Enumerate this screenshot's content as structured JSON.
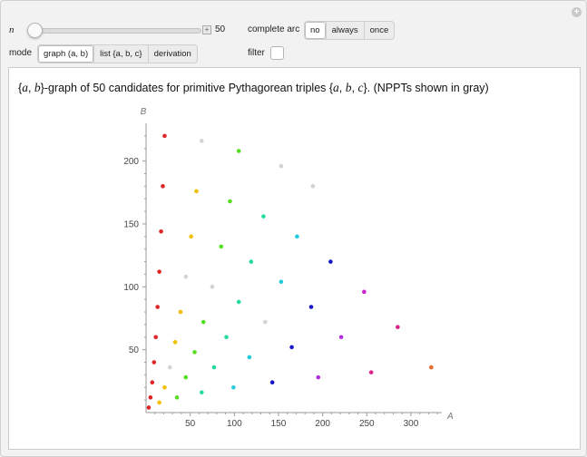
{
  "controls": {
    "n_label": "n",
    "n_value": "50",
    "n_slider_fraction": 0.02,
    "complete_arc_label": "complete arc",
    "complete_arc_options": [
      "no",
      "always",
      "once"
    ],
    "complete_arc_selected": "no",
    "mode_label": "mode",
    "mode_options": [
      "graph (a, b)",
      "list {a, b, c}",
      "derivation"
    ],
    "mode_selected": "graph (a, b)",
    "filter_label": "filter",
    "filter_checked": false
  },
  "caption": {
    "prefix": "{",
    "a1": "a",
    "comma1": ", ",
    "b1": "b",
    "middle": "}-graph of 50 candidates for primitive Pythagorean triples {",
    "a2": "a",
    "comma2": ", ",
    "b2": "b",
    "comma3": ", ",
    "c2": "c",
    "suffix": "}. (NPPTs shown in gray)"
  },
  "chart_data": {
    "type": "scatter",
    "title": "",
    "xlabel": "A",
    "ylabel": "B",
    "xlim": [
      0,
      335
    ],
    "ylim": [
      0,
      230
    ],
    "xticks": [
      50,
      100,
      150,
      200,
      250,
      300
    ],
    "yticks": [
      50,
      100,
      150,
      200
    ],
    "grid": false,
    "points": [
      {
        "x": 3,
        "y": 4,
        "color": "#e02424"
      },
      {
        "x": 5,
        "y": 12,
        "color": "#e02424"
      },
      {
        "x": 7,
        "y": 24,
        "color": "#e02424"
      },
      {
        "x": 9,
        "y": 40,
        "color": "#e02424"
      },
      {
        "x": 11,
        "y": 60,
        "color": "#e02424"
      },
      {
        "x": 13,
        "y": 84,
        "color": "#e02424"
      },
      {
        "x": 15,
        "y": 112,
        "color": "#e02424"
      },
      {
        "x": 17,
        "y": 144,
        "color": "#e02424"
      },
      {
        "x": 19,
        "y": 180,
        "color": "#e02424"
      },
      {
        "x": 21,
        "y": 220,
        "color": "#e02424"
      },
      {
        "x": 15,
        "y": 8,
        "color": "#f0c000"
      },
      {
        "x": 21,
        "y": 20,
        "color": "#f0c000"
      },
      {
        "x": 33,
        "y": 56,
        "color": "#f0c000"
      },
      {
        "x": 39,
        "y": 80,
        "color": "#f0c000"
      },
      {
        "x": 51,
        "y": 140,
        "color": "#f0c000"
      },
      {
        "x": 57,
        "y": 176,
        "color": "#f0c000"
      },
      {
        "x": 27,
        "y": 36,
        "color": "#d3d3d3"
      },
      {
        "x": 45,
        "y": 108,
        "color": "#d3d3d3"
      },
      {
        "x": 63,
        "y": 216,
        "color": "#d3d3d3"
      },
      {
        "x": 35,
        "y": 12,
        "color": "#55dd22"
      },
      {
        "x": 45,
        "y": 28,
        "color": "#55dd22"
      },
      {
        "x": 55,
        "y": 48,
        "color": "#55dd22"
      },
      {
        "x": 65,
        "y": 72,
        "color": "#55dd22"
      },
      {
        "x": 85,
        "y": 132,
        "color": "#55dd22"
      },
      {
        "x": 95,
        "y": 168,
        "color": "#55dd22"
      },
      {
        "x": 105,
        "y": 208,
        "color": "#55dd22"
      },
      {
        "x": 75,
        "y": 100,
        "color": "#d3d3d3"
      },
      {
        "x": 63,
        "y": 16,
        "color": "#22dd99"
      },
      {
        "x": 77,
        "y": 36,
        "color": "#22dd99"
      },
      {
        "x": 91,
        "y": 60,
        "color": "#22dd99"
      },
      {
        "x": 105,
        "y": 88,
        "color": "#22dd99"
      },
      {
        "x": 119,
        "y": 120,
        "color": "#22dd99"
      },
      {
        "x": 133,
        "y": 156,
        "color": "#22dd99"
      },
      {
        "x": 99,
        "y": 20,
        "color": "#22ccdd"
      },
      {
        "x": 117,
        "y": 44,
        "color": "#22ccdd"
      },
      {
        "x": 153,
        "y": 104,
        "color": "#22ccdd"
      },
      {
        "x": 171,
        "y": 140,
        "color": "#22ccdd"
      },
      {
        "x": 135,
        "y": 72,
        "color": "#d3d3d3"
      },
      {
        "x": 189,
        "y": 180,
        "color": "#d3d3d3"
      },
      {
        "x": 143,
        "y": 24,
        "color": "#1616c8"
      },
      {
        "x": 165,
        "y": 52,
        "color": "#1616c8"
      },
      {
        "x": 187,
        "y": 84,
        "color": "#1616c8"
      },
      {
        "x": 209,
        "y": 120,
        "color": "#1616c8"
      },
      {
        "x": 153,
        "y": 196,
        "color": "#d3d3d3"
      },
      {
        "x": 195,
        "y": 28,
        "color": "#b030e0"
      },
      {
        "x": 221,
        "y": 60,
        "color": "#b030e0"
      },
      {
        "x": 247,
        "y": 96,
        "color": "#cc22cc"
      },
      {
        "x": 255,
        "y": 32,
        "color": "#dd2288"
      },
      {
        "x": 285,
        "y": 68,
        "color": "#dd2288"
      },
      {
        "x": 323,
        "y": 36,
        "color": "#e86a28"
      }
    ]
  }
}
